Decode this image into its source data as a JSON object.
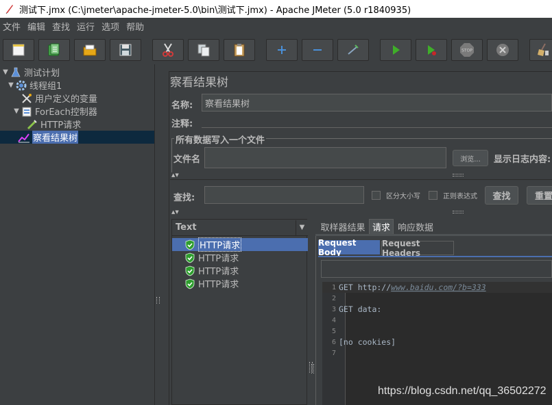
{
  "window": {
    "title": "测试下.jmx (C:\\jmeter\\apache-jmeter-5.0\\bin\\测试下.jmx) - Apache JMeter (5.0 r1840935)"
  },
  "menu": [
    "文件",
    "编辑",
    "查找",
    "运行",
    "选项",
    "帮助"
  ],
  "toolbar": {
    "buttons": [
      "new-icon",
      "templates-icon",
      "open-icon",
      "save-icon",
      "cut-icon",
      "copy-icon",
      "paste-icon",
      "expand-icon",
      "collapse-icon",
      "toggle-icon",
      "start-icon",
      "start-no-pause-icon",
      "stop-icon",
      "shutdown-icon",
      "clear-icon"
    ]
  },
  "tree": {
    "items": [
      {
        "label": "测试计划",
        "icon": "test-plan-icon",
        "level": 0,
        "expanded": true
      },
      {
        "label": "线程组1",
        "icon": "gear-icon",
        "level": 1,
        "expanded": true
      },
      {
        "label": "用户定义的变量",
        "icon": "wrench-icon",
        "level": 2
      },
      {
        "label": "ForEach控制器",
        "icon": "controller-icon",
        "level": 2,
        "expanded": true
      },
      {
        "label": "HTTP请求",
        "icon": "pipette-icon",
        "level": 3
      },
      {
        "label": "察看结果树",
        "icon": "chart-icon",
        "level": 1,
        "selected": true
      }
    ]
  },
  "panel": {
    "title": "察看结果树",
    "name_label": "名称:",
    "name_value": "察看结果树",
    "comment_label": "注释:",
    "comment_value": "",
    "file_section": "所有数据写入一个文件",
    "filename_label": "文件名",
    "filename_value": "",
    "browse_label": "浏览...",
    "log_display_label": "显示日志内容:",
    "search_label": "查找:",
    "search_value": "",
    "case_sensitive_label": "区分大小写",
    "regex_label": "正则表达式",
    "find_button": "查找",
    "reset_button": "重置"
  },
  "results": {
    "renderer": "Text",
    "samples": [
      {
        "label": "HTTP请求",
        "selected": true
      },
      {
        "label": "HTTP请求"
      },
      {
        "label": "HTTP请求"
      },
      {
        "label": "HTTP请求"
      }
    ]
  },
  "detail": {
    "tabs": [
      "取样器结果",
      "请求",
      "响应数据"
    ],
    "active_tab": "请求",
    "subtabs": [
      "Request Body",
      "Request Headers"
    ],
    "active_subtab": "Request Body",
    "lines": [
      {
        "num": "1",
        "text": "GET http://",
        "url": "www.baidu.com/?b=333"
      },
      {
        "num": "2",
        "text": ""
      },
      {
        "num": "3",
        "text": "GET data:"
      },
      {
        "num": "4",
        "text": ""
      },
      {
        "num": "5",
        "text": ""
      },
      {
        "num": "6",
        "text": "[no cookies]"
      },
      {
        "num": "7",
        "text": ""
      }
    ]
  },
  "watermark": "https://blog.csdn.net/qq_36502272",
  "colors": {
    "background": "#3c3f41",
    "selection": "#4b6eaf",
    "text": "#bbbbbb",
    "start_green": "#3fae29",
    "cut_red": "#d23a3a",
    "editor_bg": "#2b2b2b"
  }
}
